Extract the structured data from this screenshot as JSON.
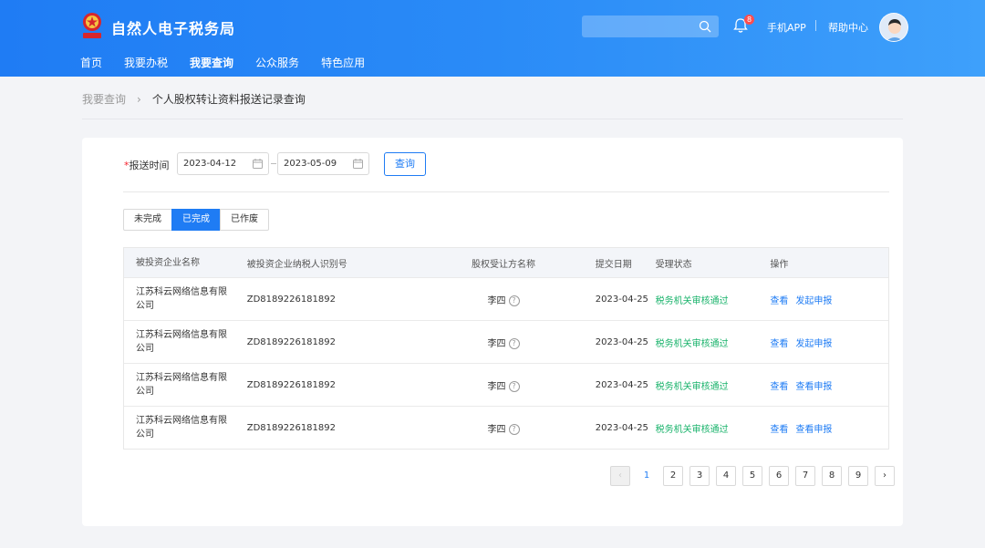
{
  "header": {
    "site_title": "自然人电子税务局",
    "bell_badge": "8",
    "mobile_app": "手机APP",
    "help_center": "帮助中心",
    "nav": [
      "首页",
      "我要办税",
      "我要查询",
      "公众服务",
      "特色应用"
    ],
    "nav_active": "我要查询"
  },
  "breadcrumb": {
    "parent": "我要查询",
    "separator": "›",
    "current": "个人股权转让资料报送记录查询"
  },
  "filter": {
    "required_mark": "*",
    "label": "报送时间",
    "start_date": "2023-04-12",
    "end_date": "2023-05-09",
    "query_button": "查询"
  },
  "tabs": [
    "未完成",
    "已完成",
    "已作废"
  ],
  "tab_active": "已完成",
  "table": {
    "headers": [
      "被投资企业名称",
      "被投资企业纳税人识别号",
      "股权受让方名称",
      "提交日期",
      "受理状态",
      "操作"
    ],
    "rows": [
      {
        "company": "江苏科云网络信息有限公司",
        "tax_id": "ZD8189226181892",
        "transferee": "李四",
        "date": "2023-04-25",
        "status": "税务机关审核通过",
        "op1": "查看",
        "op2": "发起申报"
      },
      {
        "company": "江苏科云网络信息有限公司",
        "tax_id": "ZD8189226181892",
        "transferee": "李四",
        "date": "2023-04-25",
        "status": "税务机关审核通过",
        "op1": "查看",
        "op2": "发起申报"
      },
      {
        "company": "江苏科云网络信息有限公司",
        "tax_id": "ZD8189226181892",
        "transferee": "李四",
        "date": "2023-04-25",
        "status": "税务机关审核通过",
        "op1": "查看",
        "op2": "查看申报"
      },
      {
        "company": "江苏科云网络信息有限公司",
        "tax_id": "ZD8189226181892",
        "transferee": "李四",
        "date": "2023-04-25",
        "status": "税务机关审核通过",
        "op1": "查看",
        "op2": "查看申报"
      }
    ]
  },
  "pagination": {
    "prev": "‹",
    "next": "›",
    "pages": [
      "1",
      "2",
      "3",
      "4",
      "5",
      "6",
      "7",
      "8",
      "9"
    ],
    "current": "1"
  },
  "icons": {
    "logo": "tax-emblem-icon",
    "search": "search-icon",
    "bell": "bell-icon",
    "calendar": "calendar-icon",
    "help": "question-circle-icon"
  },
  "colors": {
    "primary": "#1f7cf4",
    "status_ok": "#19b36b",
    "badge": "#ff4d4f"
  }
}
